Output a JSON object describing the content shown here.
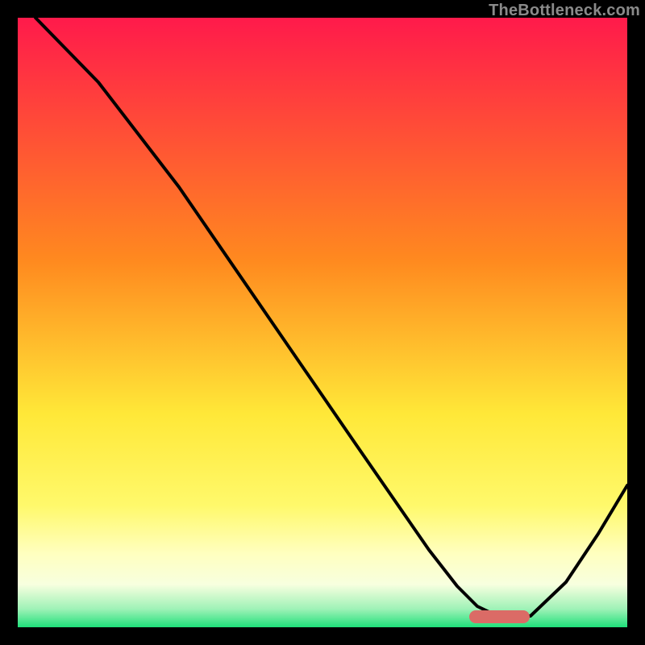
{
  "watermark": "TheBottleneck.com",
  "colors": {
    "black": "#000000",
    "curve": "#000000",
    "marker": "#db6b66",
    "red_top": "#ff1a4b",
    "orange": "#ff8a1f",
    "yellow": "#ffe838",
    "pale_yellow": "#ffffa9",
    "green": "#1fe07a"
  },
  "chart_data": {
    "type": "line",
    "title": "",
    "xlabel": "",
    "ylabel": "",
    "xlim": [
      0,
      100
    ],
    "ylim": [
      0,
      100
    ],
    "x": [
      3,
      10,
      20,
      27,
      35,
      45,
      55,
      65,
      70,
      74,
      80,
      84,
      90,
      97
    ],
    "values": [
      100,
      90,
      78,
      70,
      58,
      43,
      28,
      13,
      6,
      2,
      1,
      1,
      8,
      23
    ],
    "marker_range_x": [
      73,
      84
    ],
    "gradient_stops_pct": [
      0,
      40,
      65,
      80,
      88,
      94,
      100
    ],
    "curve_description": "Bottleneck percentage curve: steep descent from top-left, minimum near x≈78, rises toward right edge"
  }
}
